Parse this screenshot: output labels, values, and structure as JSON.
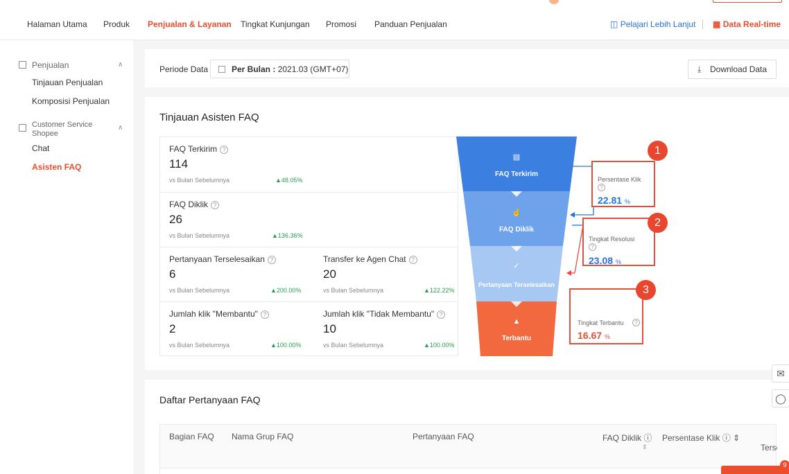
{
  "nav": {
    "items": [
      "Halaman Utama",
      "Produk",
      "Penjualan & Layanan",
      "Tingkat Kunjungan",
      "Promosi",
      "Panduan Penjualan"
    ],
    "learn_more": "Pelajari Lebih Lanjut",
    "realtime": "Data Real-time"
  },
  "sidebar": {
    "group1": "Penjualan",
    "group1_items": [
      "Tinjauan Penjualan",
      "Komposisi Penjualan"
    ],
    "group2_line1": "Customer Service",
    "group2_line2": "Shopee",
    "group2_items": [
      "Chat",
      "Asisten FAQ"
    ]
  },
  "period": {
    "label": "Periode Data",
    "mode": "Per Bulan :",
    "value": "2021.03 (GMT+07)",
    "download": "Download Data"
  },
  "overview": {
    "title": "Tinjauan Asisten FAQ",
    "vs": "vs Bulan Sebelumnya",
    "metrics": [
      {
        "label": "FAQ Terkirim",
        "value": "114",
        "change": "48.05%"
      },
      {
        "label": "FAQ Diklik",
        "value": "26",
        "change": "136.36%"
      },
      {
        "label": "Pertanyaan Terselesaikan",
        "value": "6",
        "change": "200.00%"
      },
      {
        "label": "Transfer ke Agen Chat",
        "value": "20",
        "change": "122.22%"
      },
      {
        "label": "Jumlah klik \"Membantu\"",
        "value": "2",
        "change": "100.00%"
      },
      {
        "label": "Jumlah klik \"Tidak Membantu\"",
        "value": "10",
        "change": "100.00%"
      }
    ],
    "funnel": [
      "FAQ Terkirim",
      "FAQ Diklik",
      "Pertanyaan Terselesaikan",
      "Terbantu"
    ],
    "rates": [
      {
        "label": "Persentase Klik",
        "value": "22.81",
        "unit": "%",
        "badge": "1",
        "color": "#2673dd"
      },
      {
        "label": "Tingkat Resolusi",
        "value": "23.08",
        "unit": "%",
        "badge": "2",
        "color": "#2673dd"
      },
      {
        "label": "Tingkat Terbantu",
        "value": "16.67",
        "unit": "%",
        "badge": "3",
        "color": "#e0503a"
      }
    ]
  },
  "faq_list": {
    "title": "Daftar Pertanyaan FAQ",
    "columns": [
      "Bagian FAQ",
      "Nama Grup FAQ",
      "Pertanyaan FAQ",
      "FAQ Diklik",
      "Persentase Klik",
      "Terse"
    ]
  },
  "chat_badge": "9",
  "colors": {
    "accent": "#ee4d2d",
    "link": "#2673dd",
    "up": "#2a9d57"
  }
}
